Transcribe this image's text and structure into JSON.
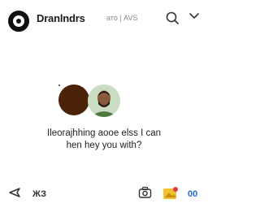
{
  "header": {
    "title": "Dranlndrs",
    "subtitle": "ато | AVS",
    "icons": [
      "logo-icon",
      "search-icon",
      "chevron-down-icon"
    ]
  },
  "main": {
    "avatars": [
      "assistant-avatar",
      "user-avatar"
    ],
    "message_line1": "Ileorajhhing aooe  elss I can",
    "message_line2": "hen hey  you with?"
  },
  "footer": {
    "left_label": "ЖЗ",
    "right_label": "00",
    "icons": [
      "send-icon",
      "camera-icon",
      "image-icon"
    ]
  },
  "colors": {
    "accent_blue": "#2a6ad6",
    "image_icon_yellow": "#f2c12e",
    "image_icon_red": "#e0393e",
    "brown_avatar": "#4a2208"
  }
}
